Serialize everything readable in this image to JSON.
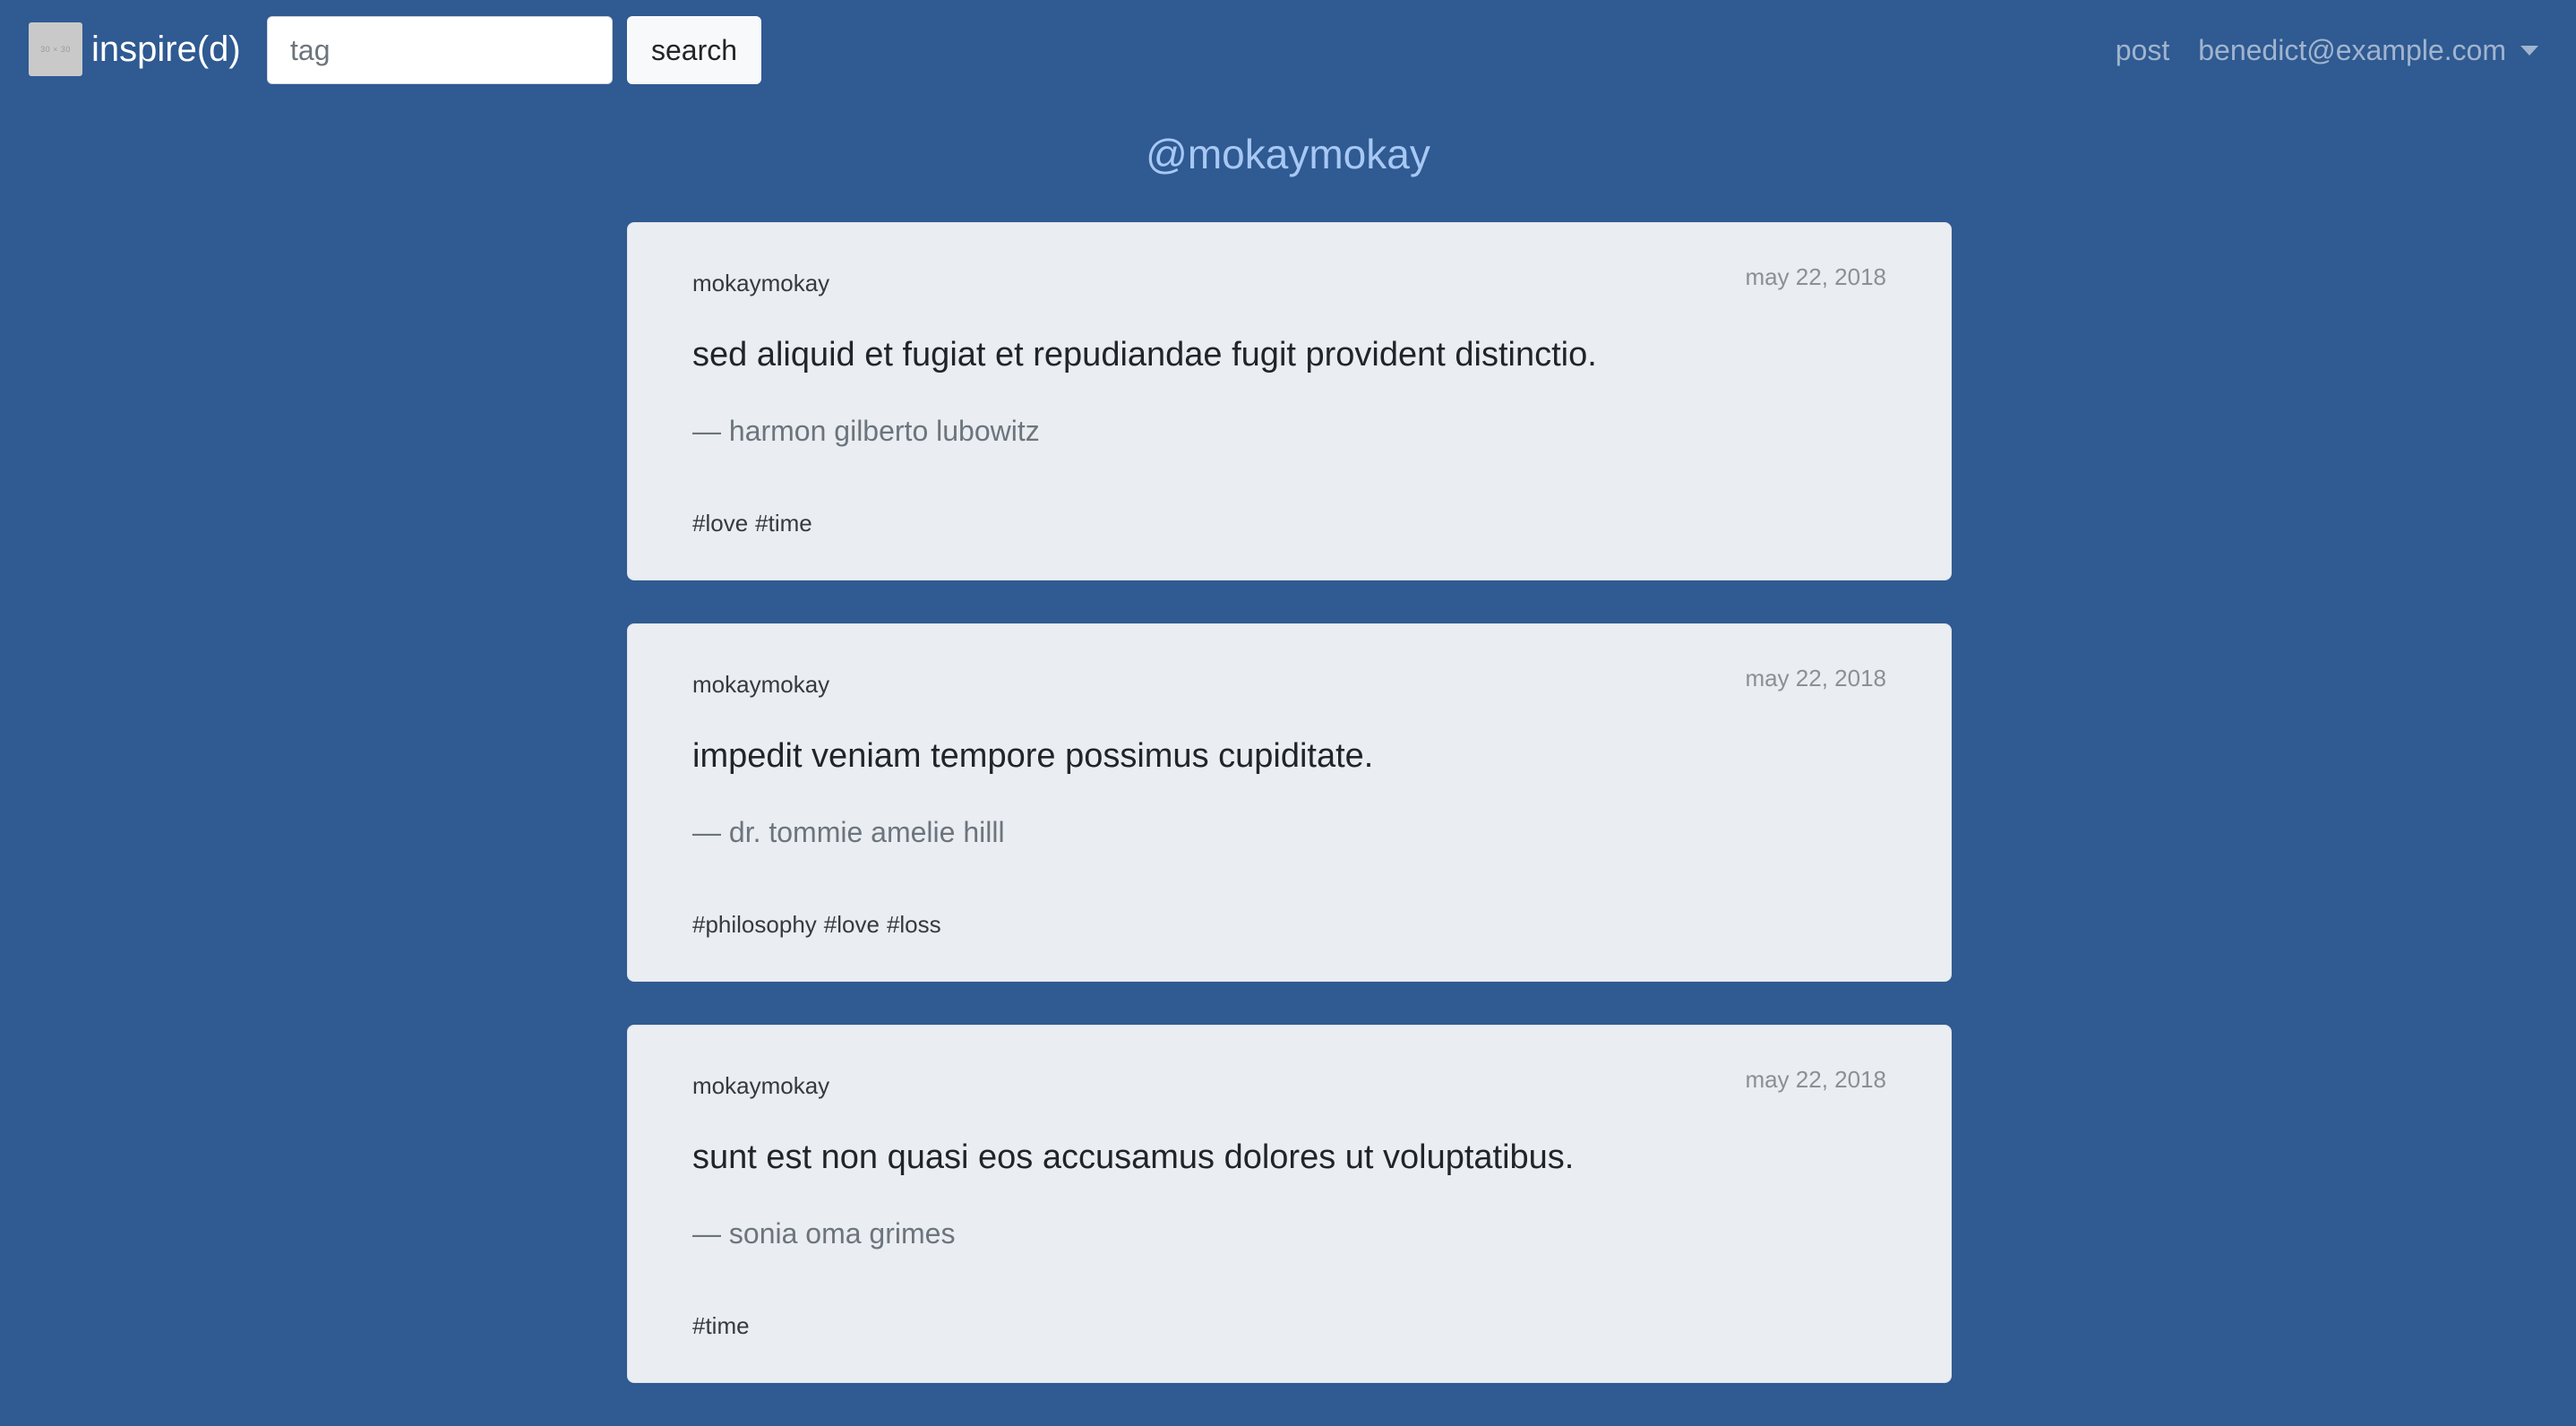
{
  "navbar": {
    "brand": {
      "logo_text": "30 × 30",
      "name": "inspire(d)"
    },
    "search": {
      "placeholder": "tag",
      "value": "",
      "button_label": "search"
    },
    "links": {
      "post": "post",
      "user_email": "benedict@example.com"
    }
  },
  "page": {
    "title": "@mokaymokay"
  },
  "posts": [
    {
      "author": "mokaymokay",
      "date": "may 22, 2018",
      "quote": "sed aliquid et fugiat et repudiandae fugit provident distinctio.",
      "attribution": "— harmon gilberto lubowitz",
      "tags": [
        "#love",
        "#time"
      ]
    },
    {
      "author": "mokaymokay",
      "date": "may 22, 2018",
      "quote": "impedit veniam tempore possimus cupiditate.",
      "attribution": "— dr. tommie amelie hilll",
      "tags": [
        "#philosophy",
        "#love",
        "#loss"
      ]
    },
    {
      "author": "mokaymokay",
      "date": "may 22, 2018",
      "quote": "sunt est non quasi eos accusamus dolores ut voluptatibus.",
      "attribution": "— sonia oma grimes",
      "tags": [
        "#time"
      ]
    }
  ]
}
